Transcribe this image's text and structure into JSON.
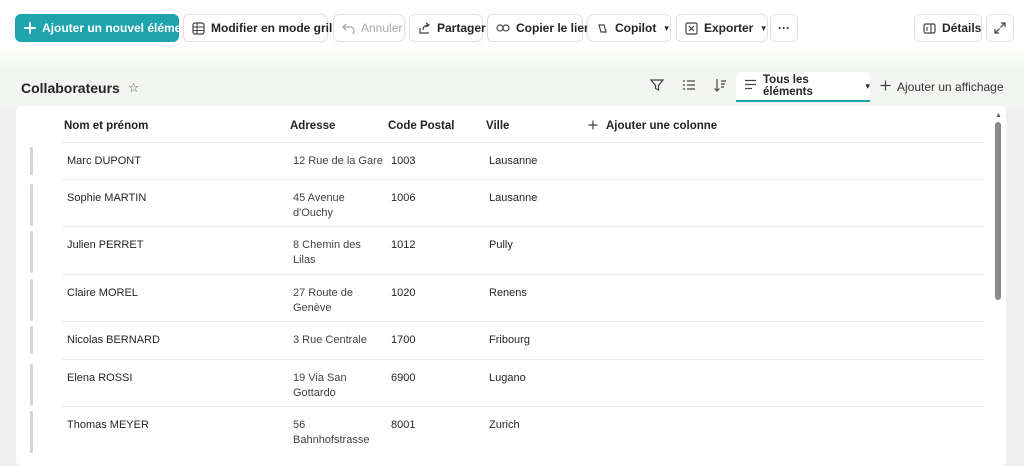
{
  "toolbar": {
    "new_item": "Ajouter un nouvel élément",
    "grid_edit": "Modifier en mode grille",
    "undo": "Annuler",
    "share": "Partager",
    "copy_link": "Copier le lien",
    "copilot": "Copilot",
    "export": "Exporter",
    "more": "···",
    "details": "Détails"
  },
  "list": {
    "title": "Collaborateurs",
    "view_name": "Tous les éléments",
    "add_view": "Ajouter un affichage"
  },
  "table": {
    "columns": [
      "Nom et prénom",
      "Adresse",
      "Code Postal",
      "Ville"
    ],
    "add_column": "Ajouter une colonne",
    "rows": [
      {
        "name": "Marc DUPONT",
        "address": "12 Rue de la Gare",
        "zip": "1003",
        "city": "Lausanne"
      },
      {
        "name": "Sophie MARTIN",
        "address": "45 Avenue d'Ouchy",
        "zip": "1006",
        "city": "Lausanne"
      },
      {
        "name": "Julien PERRET",
        "address": "8 Chemin des Lilas",
        "zip": "1012",
        "city": "Pully"
      },
      {
        "name": "Claire MOREL",
        "address": "27 Route de Genève",
        "zip": "1020",
        "city": "Renens"
      },
      {
        "name": "Nicolas BERNARD",
        "address": "3 Rue Centrale",
        "zip": "1700",
        "city": "Fribourg"
      },
      {
        "name": "Elena ROSSI",
        "address": "19 Via San Gottardo",
        "zip": "6900",
        "city": "Lugano"
      },
      {
        "name": "Thomas MEYER",
        "address": "56 Bahnhofstrasse",
        "zip": "8001",
        "city": "Zurich"
      }
    ]
  },
  "colors": {
    "accent": "#1fa3ad"
  }
}
